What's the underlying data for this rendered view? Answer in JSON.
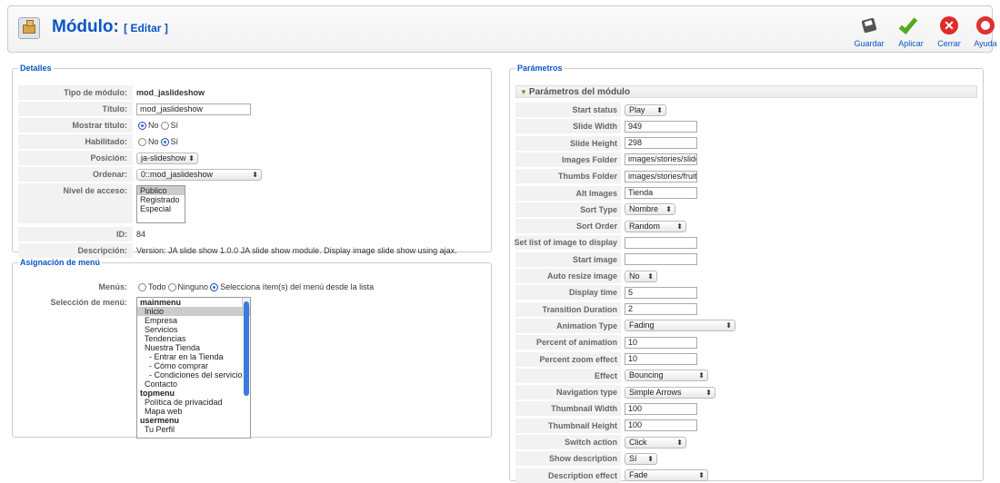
{
  "header": {
    "title": "Módulo:",
    "subtitle": "[ Editar ]"
  },
  "toolbar": {
    "save": "Guardar",
    "apply": "Aplicar",
    "close": "Cerrar",
    "help": "Ayuda"
  },
  "details": {
    "legend": "Detalles",
    "type_label": "Tipo de módulo:",
    "type_value": "mod_jaslideshow",
    "title_label": "Título:",
    "title_value": "mod_jaslideshow",
    "show_title_label": "Mostrar título:",
    "no": "No",
    "yes": "Sí",
    "enabled_label": "Habilitado:",
    "position_label": "Posición:",
    "position_value": "ja-slideshow",
    "order_label": "Ordenar:",
    "order_value": "0::mod_jaslideshow",
    "access_label": "Nivel de acceso:",
    "access_options": [
      "Público",
      "Registrado",
      "Especial"
    ],
    "id_label": "ID:",
    "id_value": "84",
    "desc_label": "Descripción:",
    "desc_value": "Version: JA slide show 1.0.0 JA slide show module. Display image slide show using ajax."
  },
  "menu": {
    "legend": "Asignación de menú",
    "menus_label": "Menús:",
    "opt_all": "Todo",
    "opt_none": "Ninguno",
    "opt_select": "Selecciona ítem(s) del menú desde la lista",
    "selection_label": "Selección de menú:",
    "items": [
      {
        "text": "mainmenu",
        "kind": "hd"
      },
      {
        "text": "  Inicio",
        "kind": "hl"
      },
      {
        "text": "  Empresa",
        "kind": ""
      },
      {
        "text": "  Servicios",
        "kind": ""
      },
      {
        "text": "  Tendencias",
        "kind": ""
      },
      {
        "text": "  Nuestra Tienda",
        "kind": ""
      },
      {
        "text": "    - Entrar en la Tienda",
        "kind": ""
      },
      {
        "text": "    - Cómo comprar",
        "kind": ""
      },
      {
        "text": "    - Condiciones del servicio",
        "kind": ""
      },
      {
        "text": "  Contacto",
        "kind": ""
      },
      {
        "text": "topmenu",
        "kind": "hd"
      },
      {
        "text": "  Política de privacidad",
        "kind": ""
      },
      {
        "text": "  Mapa web",
        "kind": ""
      },
      {
        "text": "usermenu",
        "kind": "hd"
      },
      {
        "text": "  Tu Perfil",
        "kind": ""
      }
    ]
  },
  "params": {
    "legend": "Parámetros",
    "panel_title": "Parámetros del módulo",
    "rows": [
      {
        "label": "Start status",
        "type": "select",
        "value": "Play"
      },
      {
        "label": "Slide Width",
        "type": "input",
        "value": "949"
      },
      {
        "label": "Slide Height",
        "type": "input",
        "value": "298"
      },
      {
        "label": "Images Folder",
        "type": "input",
        "value": "images/stories/slide"
      },
      {
        "label": "Thumbs Folder",
        "type": "input",
        "value": "images/stories/fruit"
      },
      {
        "label": "Alt Images",
        "type": "input",
        "value": "Tienda"
      },
      {
        "label": "Sort Type",
        "type": "select",
        "value": "Nombre"
      },
      {
        "label": "Sort Order",
        "type": "select",
        "value": "Random"
      },
      {
        "label": "Set list of image to display",
        "type": "input",
        "value": ""
      },
      {
        "label": "Start image",
        "type": "input",
        "value": ""
      },
      {
        "label": "Auto resize image",
        "type": "select",
        "value": "No"
      },
      {
        "label": "Display time",
        "type": "input",
        "value": "5"
      },
      {
        "label": "Transition Duration",
        "type": "input",
        "value": "2"
      },
      {
        "label": "Animation Type",
        "type": "select",
        "value": "Fading"
      },
      {
        "label": "Percent of animation",
        "type": "input",
        "value": "10"
      },
      {
        "label": "Percent zoom effect",
        "type": "input",
        "value": "10"
      },
      {
        "label": "Effect",
        "type": "select",
        "value": "Bouncing"
      },
      {
        "label": "Navigation type",
        "type": "select",
        "value": "Simple Arrows"
      },
      {
        "label": "Thumbnail Width",
        "type": "input",
        "value": "100"
      },
      {
        "label": "Thumbnail Height",
        "type": "input",
        "value": "100"
      },
      {
        "label": "Switch action",
        "type": "select",
        "value": "Click"
      },
      {
        "label": "Show description",
        "type": "select",
        "value": "Sí"
      },
      {
        "label": "Description effect",
        "type": "select",
        "value": "Fade"
      }
    ]
  }
}
